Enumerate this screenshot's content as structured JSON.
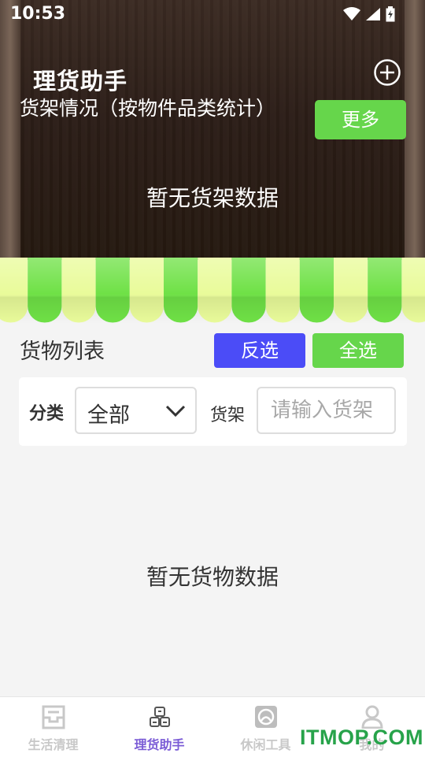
{
  "status_bar": {
    "time": "10:53"
  },
  "header": {
    "title": "理货助手",
    "subtitle": "货架情况（按物件品类统计）",
    "more_label": "更多",
    "empty_text": "暂无货架数据",
    "add_icon": "plus-circle-icon"
  },
  "goods": {
    "title": "货物列表",
    "invert_label": "反选",
    "select_all_label": "全选",
    "category_label": "分类",
    "category_value": "全部",
    "shelf_label": "货架",
    "shelf_placeholder": "请输入货架",
    "empty_text": "暂无货物数据"
  },
  "tabbar": {
    "active_index": 1,
    "items": [
      {
        "label": "生活清理",
        "icon": "inbox-icon"
      },
      {
        "label": "理货助手",
        "icon": "shelf-boxes-icon"
      },
      {
        "label": "休闲工具",
        "icon": "tools-icon"
      },
      {
        "label": "我的",
        "icon": "user-icon"
      }
    ]
  },
  "watermark": "ITMOP.COM",
  "colors": {
    "green": "#66d64b",
    "blue": "#4b4cf7",
    "purple": "#7b5cd6"
  }
}
